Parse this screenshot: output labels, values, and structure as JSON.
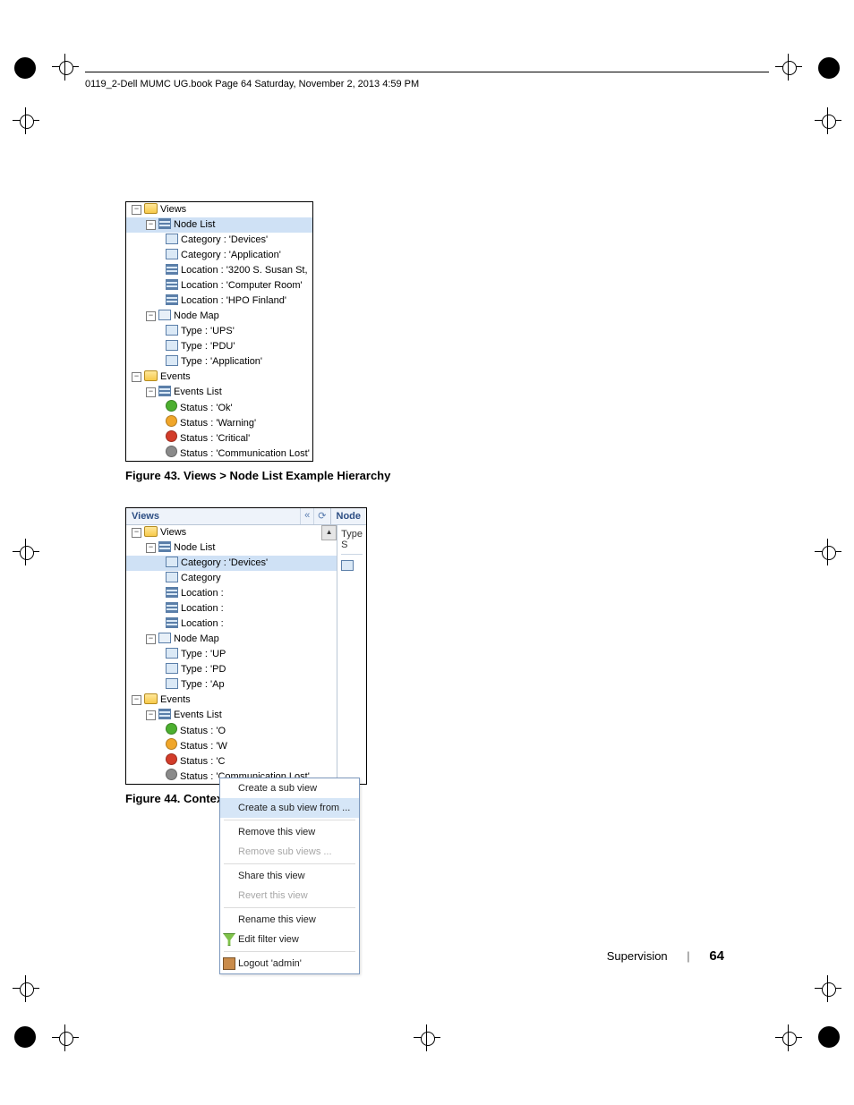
{
  "document": {
    "header": "0119_2-Dell MUMC UG.book  Page 64  Saturday, November 2, 2013  4:59 PM",
    "footer_section": "Supervision",
    "footer_page": "64"
  },
  "figure43": {
    "caption": "Figure 43.  Views > Node List Example Hierarchy",
    "tree": {
      "views": "Views",
      "node_list": "Node List",
      "cat_devices": "Category : 'Devices'",
      "cat_application": "Category : 'Application'",
      "loc_susan": "Location : '3200 S. Susan St,",
      "loc_computer": "Location : 'Computer Room'",
      "loc_hpo": "Location : 'HPO Finland'",
      "node_map": "Node Map",
      "type_ups": "Type : 'UPS'",
      "type_pdu": "Type : 'PDU'",
      "type_app": "Type : 'Application'",
      "events": "Events",
      "events_list": "Events List",
      "status_ok": "Status : 'Ok'",
      "status_warn": "Status : 'Warning'",
      "status_crit": "Status : 'Critical'",
      "status_lost": "Status : 'Communication Lost'"
    }
  },
  "figure44": {
    "caption": "Figure 44.  Contextual Sub-view Menu",
    "header_views": "Views",
    "header_node": "Node",
    "right_col_type": "Type S",
    "tree": {
      "views": "Views",
      "node_list": "Node List",
      "cat_first": "Category : 'Devices'",
      "cat_second": "Category",
      "loc1": "Location :",
      "loc2": "Location :",
      "loc3": "Location :",
      "node_map": "Node Map",
      "type_ups": "Type : 'UP",
      "type_pdu": "Type : 'PD",
      "type_app": "Type : 'Ap",
      "events": "Events",
      "events_list": "Events List",
      "s_ok": "Status : 'O",
      "s_warn": "Status : 'W",
      "s_crit": "Status : 'C",
      "s_lost": "Status : 'Communication Lost'"
    },
    "menu": {
      "create_sub": "Create a sub view",
      "create_sub_from": "Create a sub view from ...",
      "remove_view": "Remove this view",
      "remove_sub": "Remove sub views ...",
      "share_view": "Share this view",
      "revert_view": "Revert this view",
      "rename_view": "Rename this view",
      "edit_filter": "Edit filter view",
      "logout": "Logout 'admin'"
    }
  }
}
